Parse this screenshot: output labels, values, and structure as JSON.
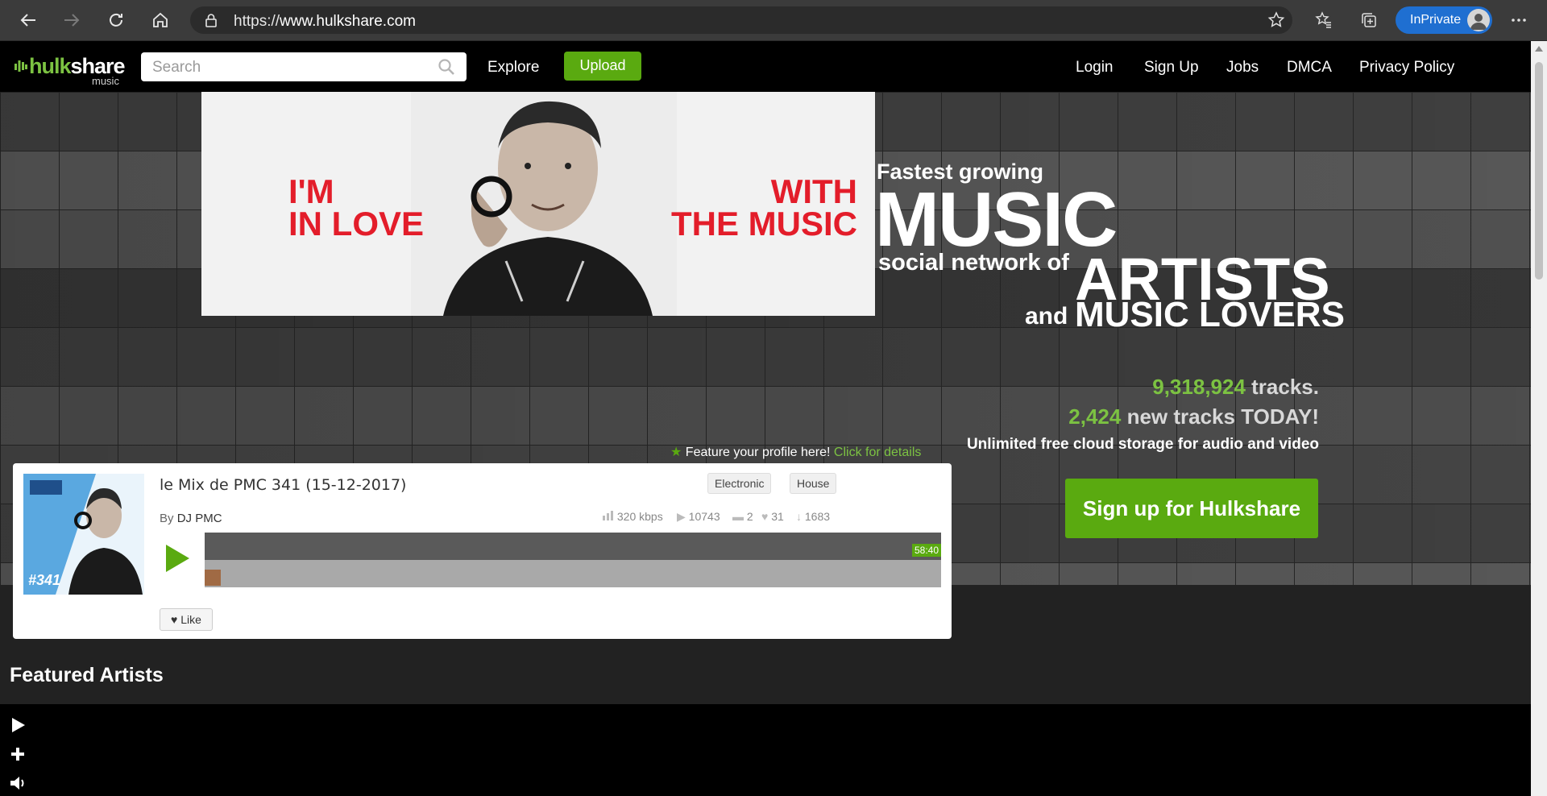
{
  "browser": {
    "url_scheme": "https://",
    "url_host": "www.hulkshare.com",
    "inprivate_label": "InPrivate",
    "icons": [
      "back-icon",
      "forward-icon",
      "refresh-icon",
      "home-icon",
      "lock-icon",
      "add-favorite-icon",
      "favorites-icon",
      "collections-icon",
      "more-icon"
    ]
  },
  "header": {
    "logo_word_a": "hulk",
    "logo_word_b": "share",
    "logo_sub": "music",
    "search_placeholder": "Search",
    "explore": "Explore",
    "upload": "Upload",
    "links": [
      "Login",
      "Sign Up",
      "Jobs",
      "DMCA",
      "Privacy Policy"
    ]
  },
  "banner": {
    "left_text": "I'M\nIN LOVE",
    "right_text": "WITH\nTHE MUSIC"
  },
  "tagline": {
    "line1": "Fastest growing",
    "line2": "MUSIC",
    "line3": "social network of",
    "line4": "ARTISTS",
    "line5a": "and",
    "line5b": "MUSIC LOVERS"
  },
  "stats": {
    "tracks_count": "9,318,924",
    "tracks_label": " tracks.",
    "new_count": "2,424",
    "new_label": " new tracks TODAY!",
    "storage": "Unlimited free cloud storage for audio and video",
    "signup_cta": "Sign up for Hulkshare"
  },
  "feature_link": {
    "text": "Feature your profile here!",
    "details": "Click for details"
  },
  "track": {
    "title": "le Mix de PMC 341 (15-12-2017)",
    "by_label": "By ",
    "artist": "DJ PMC",
    "tags": [
      "Electronic",
      "House"
    ],
    "bitrate": "320 kbps",
    "plays": "10743",
    "comments": "2",
    "likes": "31",
    "downloads": "1683",
    "duration": "58:40",
    "like_label": "Like",
    "cover_badge": "#341"
  },
  "featured_title": "Featured Artists",
  "colors": {
    "brand_green": "#5aaa10",
    "accent_green": "#7cc242",
    "banner_red": "#e31d2a",
    "inprivate_blue": "#1f6fd1"
  }
}
